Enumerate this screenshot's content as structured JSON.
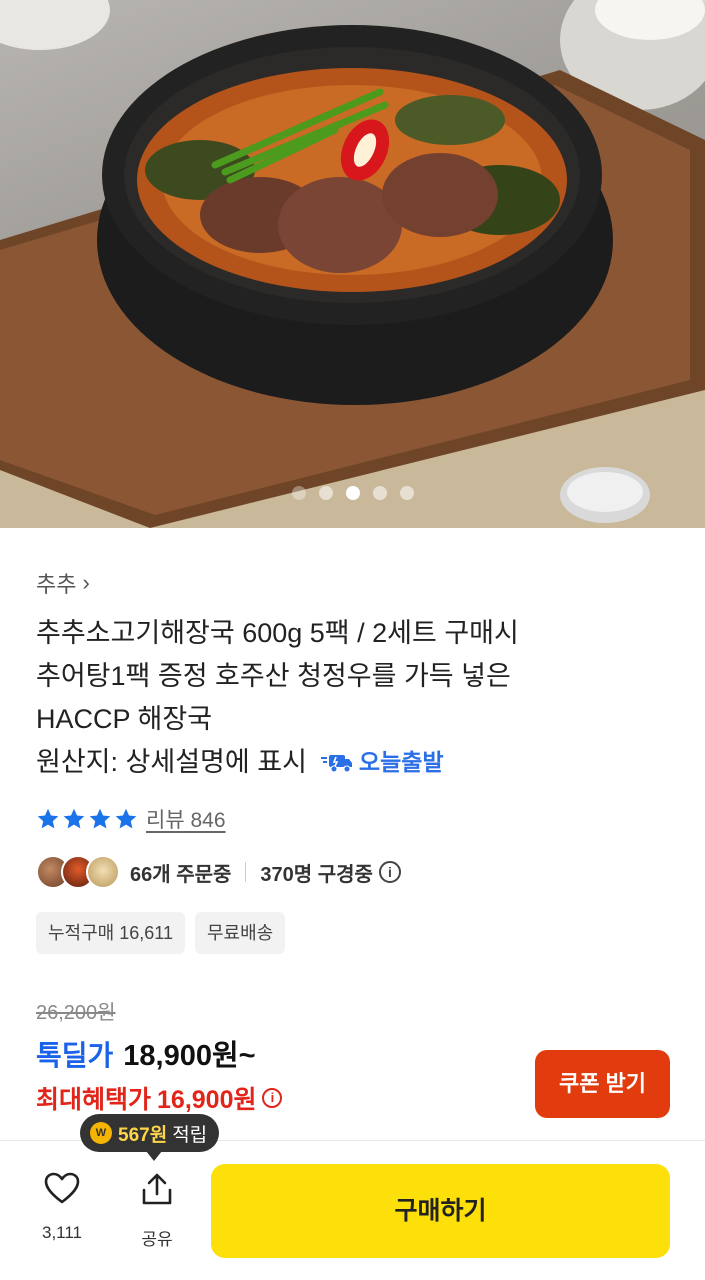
{
  "gallery": {
    "dot_count": 5,
    "active_index": 2
  },
  "seller": {
    "name": "추추"
  },
  "product": {
    "title_lines": [
      "추추소고기해장국 600g 5팩 / 2세트 구매시",
      "추어탕1팩 증정 호주산 청정우를 가득 넣은",
      "HACCP 해장국"
    ],
    "origin": "원산지: 상세설명에 표시",
    "delivery_badge": "오늘출발"
  },
  "rating": {
    "stars": 4,
    "review_text": "리뷰 846"
  },
  "social": {
    "orders": "66개 주문중",
    "viewers": "370명 구경중"
  },
  "tags": [
    "누적구매 16,611",
    "무료배송"
  ],
  "price": {
    "original": "26,200원",
    "deal_label": "톡딜가",
    "deal_price": "18,900원~",
    "max_label": "최대혜택가",
    "max_price": "16,900원"
  },
  "coupon": {
    "label": "쿠폰 받기"
  },
  "points": {
    "amount": "567원",
    "suffix": "적립"
  },
  "bottom": {
    "like_count": "3,111",
    "share_label": "공유",
    "buy_label": "구매하기"
  },
  "colors": {
    "deal_blue": "#1a63e8",
    "benefit_red": "#e1251b",
    "buy_yellow": "#fde00a",
    "coupon_red": "#e23b0e",
    "star_blue": "#1a73e8"
  }
}
